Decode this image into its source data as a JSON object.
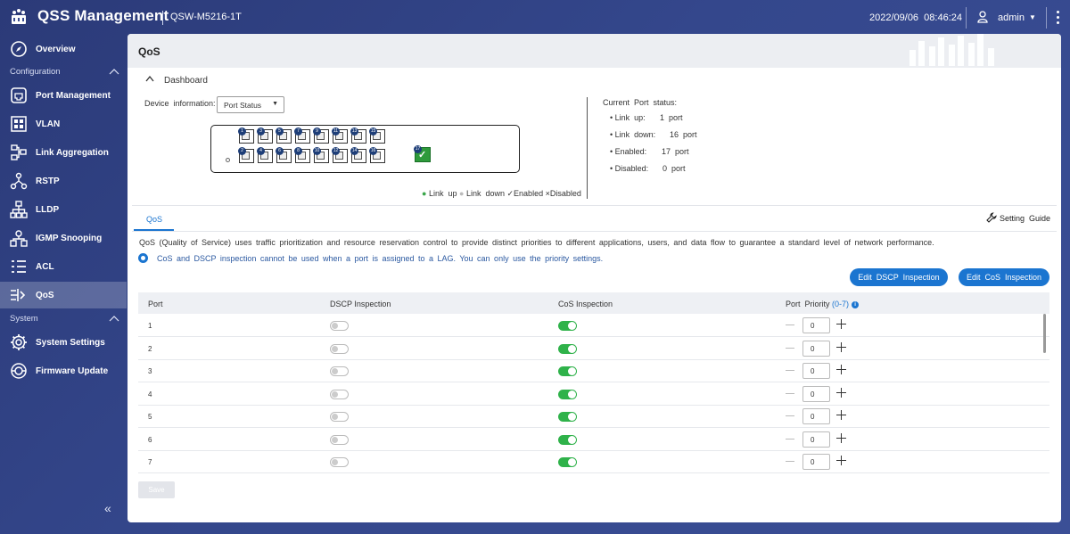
{
  "header": {
    "app_title": "QSS Management",
    "model": "QSW-M5216-1T",
    "datetime": "2022/09/06  08:46:24",
    "username": "admin"
  },
  "sidebar": {
    "overview": "Overview",
    "section_configuration": "Configuration",
    "items": [
      {
        "label": "Port Management",
        "icon": "port-icon"
      },
      {
        "label": "VLAN",
        "icon": "vlan-icon"
      },
      {
        "label": "Link Aggregation",
        "icon": "link-aggregation-icon"
      },
      {
        "label": "RSTP",
        "icon": "rstp-icon"
      },
      {
        "label": "LLDP",
        "icon": "lldp-icon"
      },
      {
        "label": "IGMP Snooping",
        "icon": "igmp-icon"
      },
      {
        "label": "ACL",
        "icon": "acl-icon"
      },
      {
        "label": "QoS",
        "icon": "qos-icon"
      }
    ],
    "section_system": "System",
    "system_items": [
      {
        "label": "System Settings",
        "icon": "gear-icon"
      },
      {
        "label": "Firmware Update",
        "icon": "firmware-icon"
      }
    ],
    "collapse_label": "«"
  },
  "page": {
    "title": "QoS",
    "dashboard_title": "Dashboard",
    "device_info_label": "Device  information:",
    "device_select_value": "Port Status",
    "ports_top": [
      "1",
      "3",
      "5",
      "7",
      "9",
      "11",
      "13",
      "15"
    ],
    "ports_bottom": [
      "2",
      "4",
      "6",
      "8",
      "10",
      "12",
      "14",
      "16"
    ],
    "port_sfp": "17",
    "legend": {
      "link_up": "Link  up",
      "link_down": "Link  down",
      "enabled": "Enabled",
      "disabled": "Disabled"
    },
    "status": {
      "title": "Current  Port  status:",
      "link_up_label": "Link  up:",
      "link_up_value": "1  port",
      "link_down_label": "Link  down:",
      "link_down_value": "16  port",
      "enabled_label": "Enabled:",
      "enabled_value": "17  port",
      "disabled_label": "Disabled:",
      "disabled_value": "0  port"
    },
    "tab_label": "QoS",
    "setting_guide": "Setting  Guide",
    "description": "QoS (Quality of Service) uses traffic prioritization and resource reservation control to provide distinct priorities to different applications, users, and data flow to guarantee a standard level of network performance.",
    "note": "CoS and DSCP inspection cannot be used when a port is assigned to a LAG. You can only use the priority settings.",
    "edit_dscp_button": "Edit  DSCP  Inspection",
    "edit_cos_button": "Edit  CoS  Inspection",
    "save_button": "Save"
  },
  "table": {
    "headers": {
      "port": "Port",
      "dscp": "DSCP  Inspection",
      "cos": "CoS  Inspection",
      "priority": "Port  Priority",
      "priority_range": "(0-7)"
    },
    "rows": [
      {
        "port": "1",
        "dscp": false,
        "cos": true,
        "priority": "0"
      },
      {
        "port": "2",
        "dscp": false,
        "cos": true,
        "priority": "0"
      },
      {
        "port": "3",
        "dscp": false,
        "cos": true,
        "priority": "0"
      },
      {
        "port": "4",
        "dscp": false,
        "cos": true,
        "priority": "0"
      },
      {
        "port": "5",
        "dscp": false,
        "cos": true,
        "priority": "0"
      },
      {
        "port": "6",
        "dscp": false,
        "cos": true,
        "priority": "0"
      },
      {
        "port": "7",
        "dscp": false,
        "cos": true,
        "priority": "0"
      }
    ]
  },
  "colors": {
    "accent": "#1b75d0",
    "toggle_on": "#2fb24a",
    "background": "#2f4186"
  }
}
